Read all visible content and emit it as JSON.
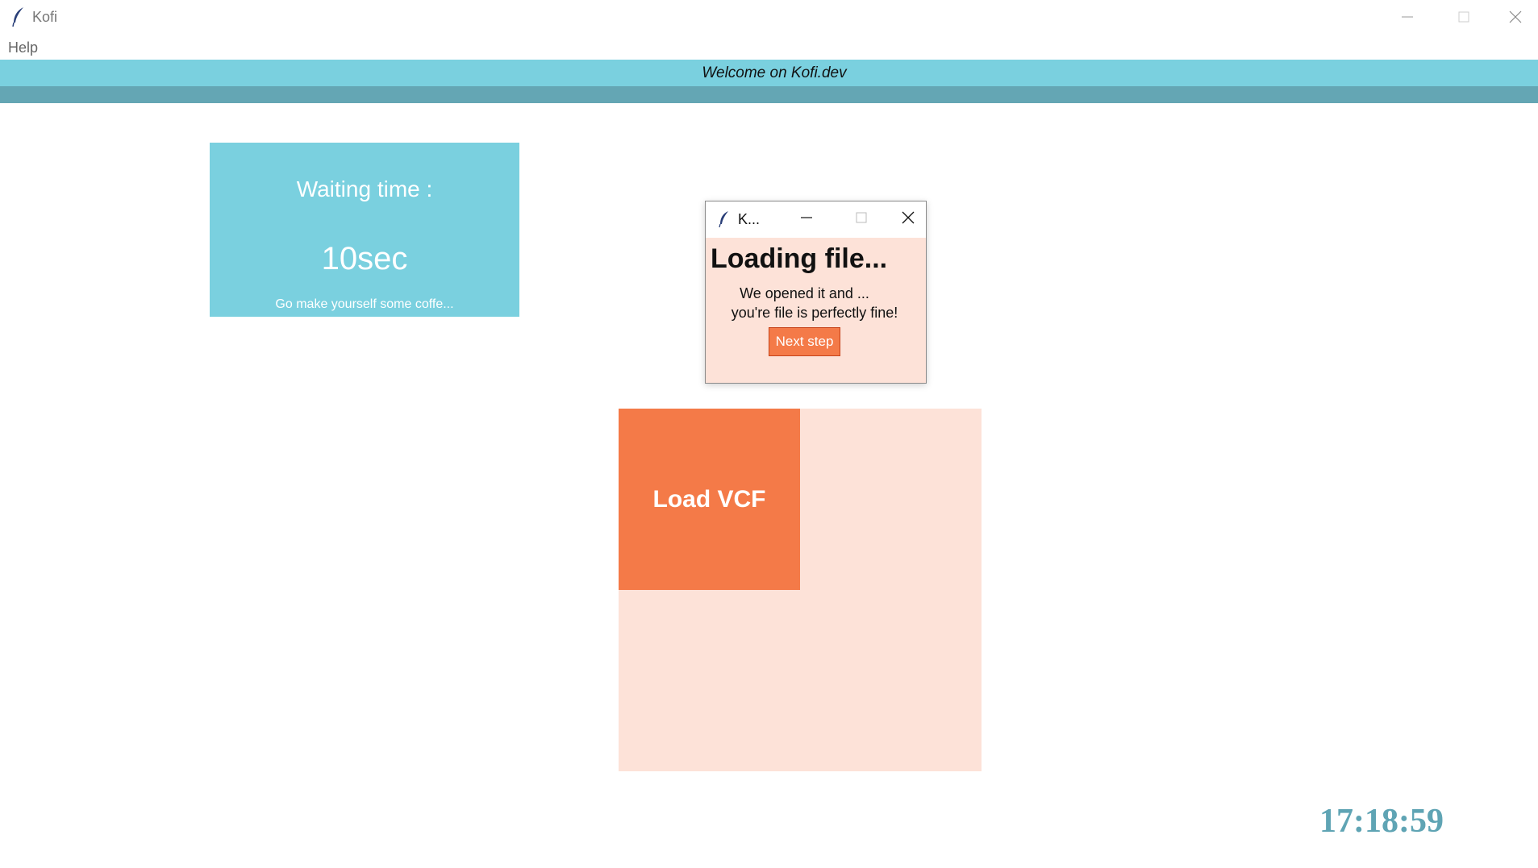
{
  "window": {
    "title": "Kofi",
    "app_icon": "feather-icon",
    "controls": {
      "minimize": "minimize-icon",
      "maximize": "maximize-icon",
      "close": "close-icon"
    }
  },
  "menu": {
    "items": [
      {
        "label": "Help"
      }
    ]
  },
  "banner": {
    "text": "Welcome on Kofi.dev",
    "bg_color": "#7ad0df",
    "stripe_color": "#64a6b4"
  },
  "waiting": {
    "label": "Waiting time :",
    "value": "10sec",
    "note": "Go make yourself some coffe..."
  },
  "dialog": {
    "title": "K...",
    "heading": "Loading file...",
    "line1": "We opened it and ...",
    "line2": "you're file is perfectly fine!",
    "button_label": "Next step",
    "button_color": "#f47a48"
  },
  "load": {
    "button_label": "Load VCF",
    "accent": "#f47a48",
    "panel_color": "#fde2d8"
  },
  "clock": {
    "time": "17:18:59"
  }
}
